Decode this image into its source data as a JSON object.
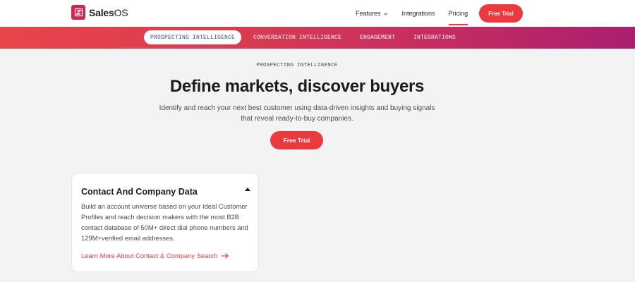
{
  "brand": {
    "name_bold": "Sales",
    "name_rest": "OS",
    "logo_glyph": "Z",
    "accent": "#ea3a3f",
    "brand_pink": "#d6254c"
  },
  "nav": {
    "links": [
      {
        "label": "Features",
        "has_dropdown": true
      },
      {
        "label": "Integrations",
        "has_dropdown": false
      },
      {
        "label": "Pricing",
        "has_dropdown": false,
        "active": true
      }
    ],
    "cta": "Free Trial"
  },
  "tabs": [
    {
      "label": "PROSPECTING INTELLIGENCE",
      "active": true
    },
    {
      "label": "CONVERSATION INTELLIGENCE",
      "active": false
    },
    {
      "label": "ENGAGEMENT",
      "active": false
    },
    {
      "label": "INTEGRATIONS",
      "active": false
    }
  ],
  "hero": {
    "eyebrow": "PROSPECTING INTELLIGENCE",
    "title": "Define markets, discover buyers",
    "subtitle": "Identify and reach your next best customer using data-driven insights and buying signals that reveal ready-to-buy companies.",
    "cta": "Free Trial"
  },
  "card": {
    "title": "Contact And Company Data",
    "expanded": true,
    "body": "Build an account universe based on your Ideal Customer Profiles and reach decision makers with the most B2B contact database of 50M+ direct dial phone numbers and 129M+verified email addresses.",
    "link": "Learn More About Contact & Company Search"
  },
  "icons": {
    "dropdown": "chevron-down-icon",
    "collapse": "caret-up-icon",
    "link_arrow": "arrow-right-icon"
  }
}
